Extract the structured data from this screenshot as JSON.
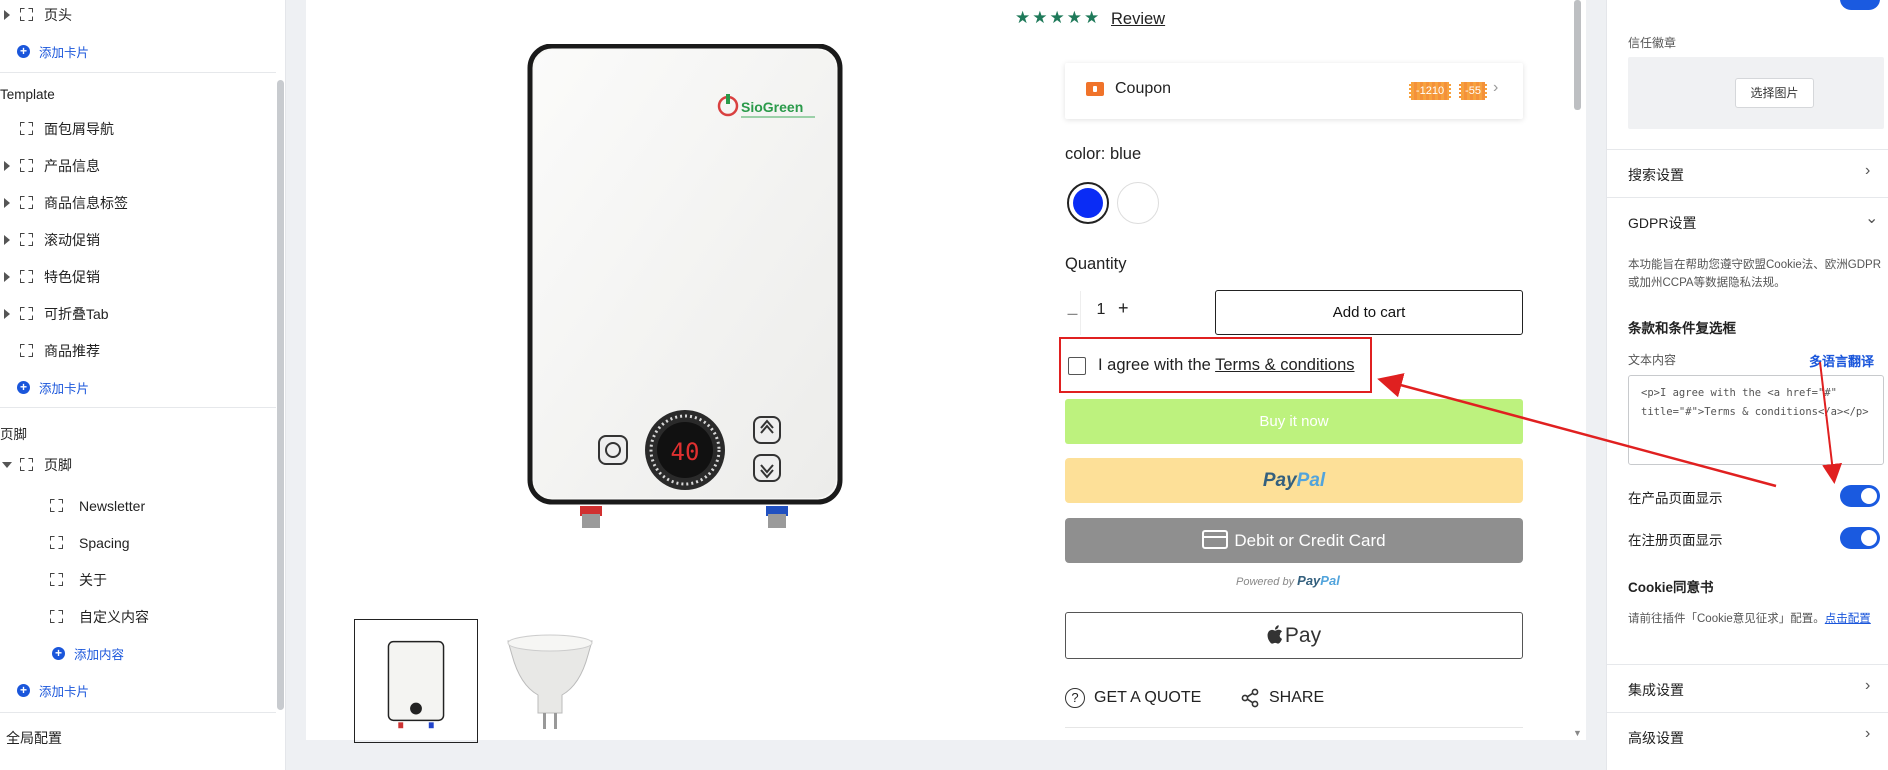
{
  "left_panel": {
    "items": [
      {
        "label": "页头"
      },
      {
        "label": "添加卡片"
      },
      {
        "label": "Template"
      },
      {
        "label": "面包屑导航"
      },
      {
        "label": "产品信息"
      },
      {
        "label": "商品信息标签"
      },
      {
        "label": "滚动促销"
      },
      {
        "label": "特色促销"
      },
      {
        "label": "可折叠Tab"
      },
      {
        "label": "商品推荐"
      },
      {
        "label": "添加卡片"
      },
      {
        "label": "页脚"
      },
      {
        "label": "页脚"
      },
      {
        "label": "Newsletter"
      },
      {
        "label": "Spacing"
      },
      {
        "label": "关于"
      },
      {
        "label": "自定义内容"
      },
      {
        "label": "添加内容"
      },
      {
        "label": "添加卡片"
      }
    ],
    "global_config": "全局配置"
  },
  "product": {
    "review_link": "Review",
    "rating": 4.5,
    "coupon": {
      "label": "Coupon",
      "tag1": "-1210",
      "tag2": "-55"
    },
    "color_label": "color:",
    "color_value": "blue",
    "colors": [
      {
        "name": "blue",
        "hex": "#0a2cf5",
        "selected": true
      },
      {
        "name": "white",
        "hex": "#ffffff",
        "selected": false
      }
    ],
    "quantity_label": "Quantity",
    "quantity_minus": "–",
    "quantity_value": "1",
    "quantity_plus": "+",
    "add_to_cart": "Add to cart",
    "agree_text": "I agree with the ",
    "agree_link": "Terms & conditions",
    "buy_now": "Buy it now",
    "paypal_1": "Pay",
    "paypal_2": "Pal",
    "card_button": "Debit or Credit Card",
    "powered_by": "Powered by ",
    "apple_pay": "Pay",
    "get_quote": "GET A QUOTE",
    "share": "SHARE",
    "device_display": "40",
    "brand": "SioGreen"
  },
  "right_panel": {
    "trust_badge_label": "信任徽章",
    "choose_image": "选择图片",
    "search_settings": "搜索设置",
    "gdpr_settings": "GDPR设置",
    "gdpr_desc": "本功能旨在帮助您遵守欧盟Cookie法、欧洲GDPR或加州CCPA等数据隐私法规。",
    "terms_title": "条款和条件复选框",
    "text_content_label": "文本内容",
    "multi_language": "多语言翻译",
    "terms_html": "<p>I agree with the <a href=\"#\" title=\"#\">Terms & conditions</a></p>",
    "show_on_product": "在产品页面显示",
    "show_on_register": "在注册页面显示",
    "cookie_title": "Cookie同意书",
    "cookie_desc": "请前往插件「Cookie意见征求」配置。",
    "cookie_link": "点击配置",
    "integration_settings": "集成设置",
    "advanced_settings": "高级设置",
    "toggles": {
      "show_on_product": true,
      "show_on_register": true
    }
  },
  "colors": {
    "accent": "#1a56db",
    "annotation": "#e02020",
    "buy_now": "#bdf27e",
    "paypal": "#fde098",
    "card": "#8f8f8f"
  }
}
